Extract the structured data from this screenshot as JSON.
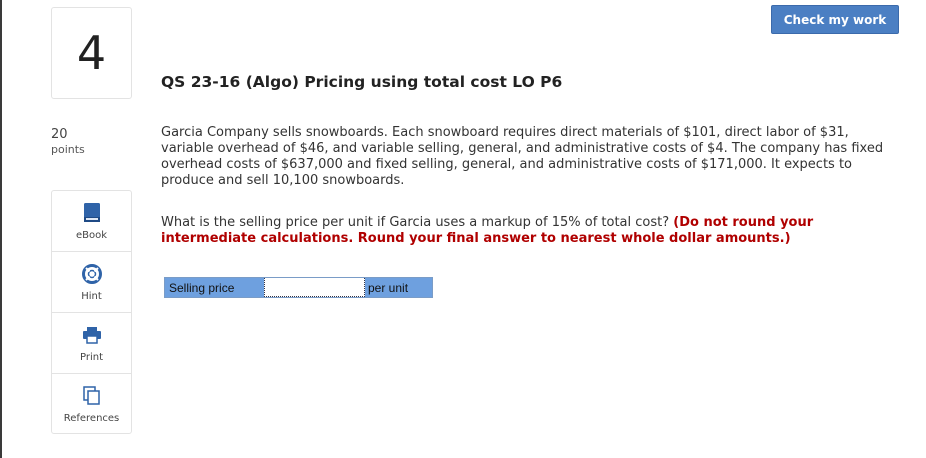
{
  "question": {
    "number": "4",
    "points_value": "20",
    "points_label": "points"
  },
  "sidebar_tools": [
    {
      "label": "eBook",
      "icon": "book-icon"
    },
    {
      "label": "Hint",
      "icon": "lifebuoy-icon"
    },
    {
      "label": "Print",
      "icon": "printer-icon"
    },
    {
      "label": "References",
      "icon": "copy-icon"
    }
  ],
  "header": {
    "check_button": "Check my work",
    "accent_color": "#4b7fc3"
  },
  "problem": {
    "title": "QS 23-16 (Algo) Pricing using total cost LO P6",
    "paragraph": "Garcia Company sells snowboards. Each snowboard requires direct materials of $101, direct labor of $31, variable overhead of $46, and variable selling, general, and administrative costs of $4. The company has fixed overhead costs of $637,000 and fixed selling, general, and administrative costs of $171,000. It expects to produce and sell 10,100 snowboards.",
    "question": "What is the selling price per unit if Garcia uses a markup of 15% of total cost?",
    "instruction": "(Do not round your intermediate calculations. Round your final answer to nearest whole dollar amounts.)",
    "instruction_color": "#b00000"
  },
  "answer": {
    "label": "Selling price",
    "value": "",
    "unit": "per unit"
  }
}
